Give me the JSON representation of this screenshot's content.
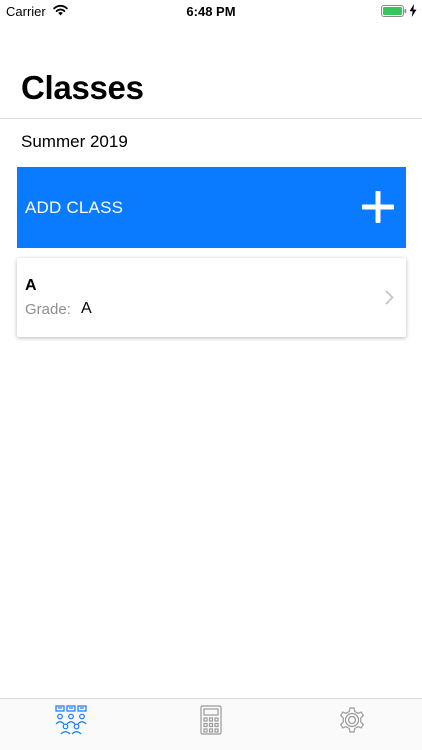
{
  "status_bar": {
    "carrier": "Carrier",
    "time": "6:48 PM",
    "battery_color": "#34c759"
  },
  "header": {
    "title": "Classes",
    "term": "Summer 2019"
  },
  "add_class": {
    "label": "ADD CLASS",
    "background_color": "#0a7aff",
    "icon": "plus-icon"
  },
  "classes": [
    {
      "name": "A",
      "grade_label": "Grade:",
      "grade_value": "A"
    }
  ],
  "tab_bar": {
    "active_color": "#0a7aff",
    "inactive_color": "#9a9a9a",
    "tabs": [
      {
        "icon": "classroom-icon",
        "active": true
      },
      {
        "icon": "calculator-icon",
        "active": false
      },
      {
        "icon": "gear-icon",
        "active": false
      }
    ]
  }
}
